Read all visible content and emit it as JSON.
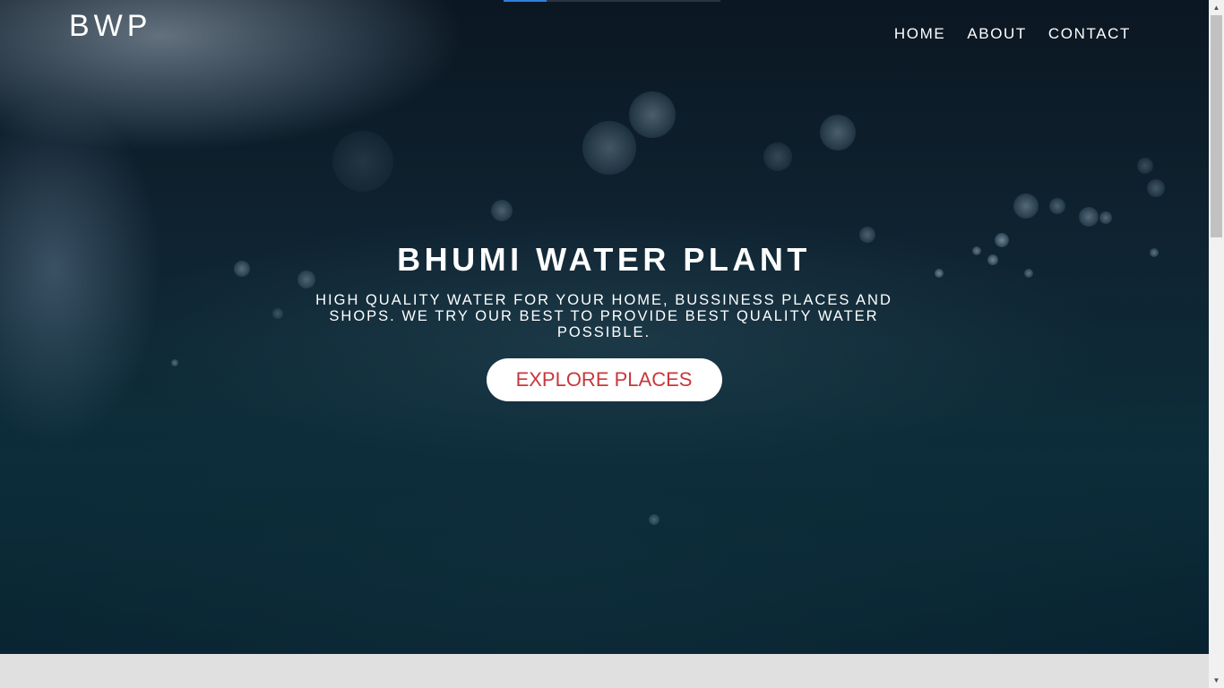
{
  "header": {
    "brand": "BWP",
    "nav": [
      {
        "label": "HOME"
      },
      {
        "label": "ABOUT"
      },
      {
        "label": "CONTACT"
      }
    ]
  },
  "hero": {
    "title": "BHUMI WATER PLANT",
    "subtitle": "HIGH QUALITY WATER FOR YOUR HOME, BUSSINESS PLACES AND SHOPS. WE TRY OUR BEST TO PROVIDE BEST QUALITY WATER POSSIBLE.",
    "cta_label": "EXPLORE PLACES",
    "slide_progress": 0.2
  },
  "colors": {
    "cta_text": "#c8373c",
    "cta_background": "#ffffff",
    "progress_fill": "#2f7fe0"
  },
  "scrollbar": {
    "up_icon": "triangle-up-icon",
    "down_icon": "triangle-down-icon"
  }
}
